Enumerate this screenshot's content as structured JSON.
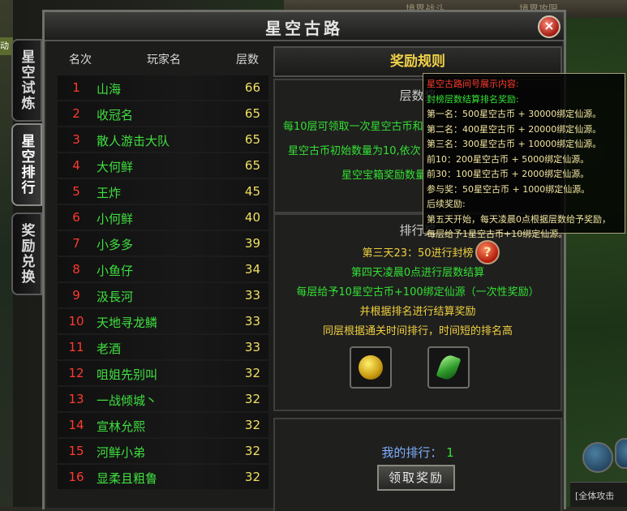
{
  "window": {
    "title": "星空古路",
    "close_glyph": "×"
  },
  "background": {
    "top_labels": [
      "境界战斗",
      "境界攻限"
    ],
    "hud_text": "[全体攻击"
  },
  "side_tabs": [
    {
      "label": "星空试炼",
      "active": false
    },
    {
      "label": "星空排行",
      "active": true
    },
    {
      "label": "奖励兑换",
      "active": false
    }
  ],
  "left_mini_label": "动",
  "ranking": {
    "headers": {
      "rank": "名次",
      "player": "玩家名",
      "floor": "层数"
    },
    "rows": [
      {
        "rank": "1",
        "name": "山海",
        "floor": "66"
      },
      {
        "rank": "2",
        "name": "收冠名",
        "floor": "65"
      },
      {
        "rank": "3",
        "name": "散人游击大队",
        "floor": "65"
      },
      {
        "rank": "4",
        "name": "大何鲜",
        "floor": "65"
      },
      {
        "rank": "5",
        "name": "王炸",
        "floor": "45"
      },
      {
        "rank": "6",
        "name": "小何鲜",
        "floor": "40"
      },
      {
        "rank": "7",
        "name": "小多多",
        "floor": "39"
      },
      {
        "rank": "8",
        "name": "小鱼仔",
        "floor": "34"
      },
      {
        "rank": "9",
        "name": "汲長河",
        "floor": "33"
      },
      {
        "rank": "10",
        "name": "天地寻龙鳞",
        "floor": "33"
      },
      {
        "rank": "11",
        "name": "老酒",
        "floor": "33"
      },
      {
        "rank": "12",
        "name": "咀姐先别叫",
        "floor": "32"
      },
      {
        "rank": "13",
        "name": "一战倾城丶",
        "floor": "32"
      },
      {
        "rank": "14",
        "name": "宣林允熙",
        "floor": "32"
      },
      {
        "rank": "15",
        "name": "河鲜小弟",
        "floor": "32"
      },
      {
        "rank": "16",
        "name": "显柔且粗鲁",
        "floor": "32"
      }
    ]
  },
  "rules": {
    "title": "奖励规则",
    "floor_reward": {
      "heading": "层数奖",
      "lines": [
        "每10层可领取一次星空古币和",
        "星空古币初始数量为10,依次",
        "星空宝箱奖励数量"
      ]
    },
    "rank_reward": {
      "heading": "排行奖",
      "lines": [
        "第三天23：50进行封榜",
        "第四天凌晨0点进行层数结算",
        "每层给予10星空古币+100绑定仙源（一次性奖励）",
        "并根据排名进行结算奖励",
        "同层根据通关时间排行，时间短的排名高"
      ],
      "items": [
        {
          "icon": "gold-coin-icon"
        },
        {
          "icon": "green-gem-icon"
        }
      ]
    },
    "my_rank": {
      "label": "我的排行：",
      "value": "1"
    },
    "claim_button": "领取奖励",
    "help_glyph": "?"
  },
  "tooltip": {
    "title": "星空古路间号展示内容:",
    "subtitle": "封榜层数结算排名奖励:",
    "lines": [
      "第一名：500星空古币 + 30000绑定仙源。",
      "第二名：400星空古币 + 20000绑定仙源。",
      "第三名：300星空古币 + 10000绑定仙源。",
      "前10：200星空古币 + 5000绑定仙源。",
      "前30：100星空古币 + 2000绑定仙源。",
      "参与奖：50星空古币 + 1000绑定仙源。",
      "后续奖励:",
      "第五天开始，每天凌晨0点根据层数给予奖励，",
      "每层给予1星空古币+10绑定仙源。"
    ]
  },
  "colors": {
    "rank_number": "#ff3a2e",
    "player_name": "#3fe03f",
    "floor_value": "#f0e060",
    "rule_title": "#f1d148"
  }
}
